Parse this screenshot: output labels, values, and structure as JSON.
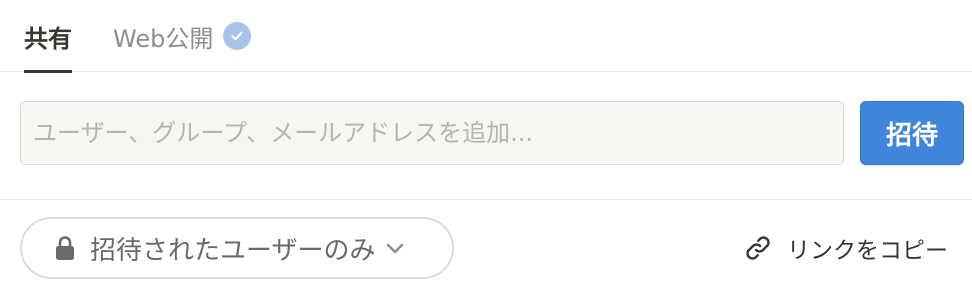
{
  "tabs": [
    {
      "label": "共有",
      "active": true
    },
    {
      "label": "Web公開",
      "active": false,
      "icon": "verified-check-icon"
    }
  ],
  "invite": {
    "placeholder": "ユーザー、グループ、メールアドレスを追加...",
    "value": "",
    "button_label": "招待",
    "button_color": "#3f86da"
  },
  "access": {
    "icon": "lock-icon",
    "label": "招待されたユーザーのみ",
    "chevron": "chevron-down-icon"
  },
  "copy_link": {
    "icon": "link-icon",
    "label": "リンクをコピー"
  },
  "colors": {
    "text": "#37352f",
    "muted": "#8f8e8a",
    "accent": "#3f86da",
    "verified_badge": "#a8c3ea",
    "divider": "#e9e9e7"
  }
}
